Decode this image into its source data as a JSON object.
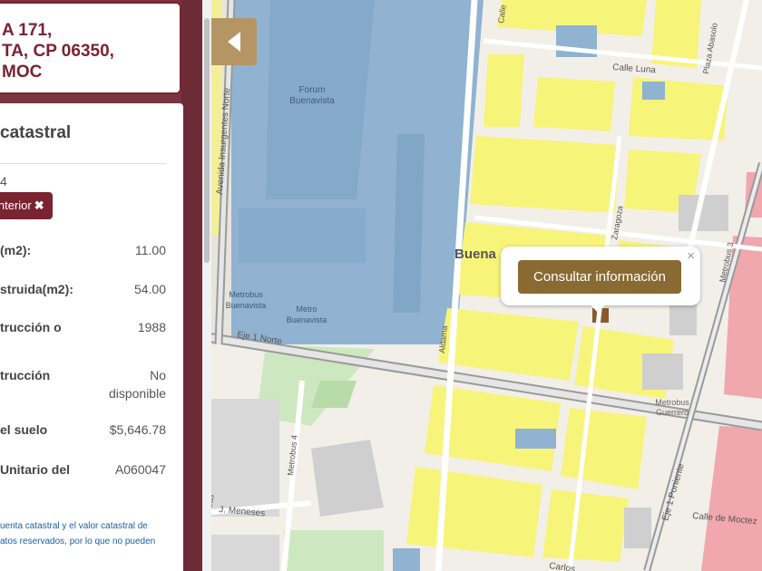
{
  "address": {
    "text": "A 171,\nTA, CP 06350,\nMOC"
  },
  "info": {
    "title": "catastral",
    "number_partial": "4",
    "tag_label": "interior",
    "tag_close_icon": "close-icon",
    "rows": [
      {
        "label": "(m2):",
        "value": "11.00"
      },
      {
        "label": "struida(m2):",
        "value": "54.00"
      },
      {
        "label": "trucción o",
        "value": "1988"
      },
      {
        "label": "trucción",
        "value": "No disponible"
      },
      {
        "label": "el suelo",
        "value": "$5,646.78"
      },
      {
        "label": "Unitario del",
        "value": "A060047"
      }
    ],
    "disclaimer": "uenta catastral y el valor catastral de\natos reservados, por lo que no pueden"
  },
  "panel_toggle": {
    "icon": "chevron-left-icon"
  },
  "popup": {
    "button_label": "Consultar información",
    "close_label": "×"
  },
  "map": {
    "colors": {
      "federal": "#8fb3d0",
      "habitacional": "#f7f47a",
      "mixto": "#f0a7ae",
      "selected": "#8b5a2b",
      "base": "#f2efe9",
      "park": "#cde8c0"
    },
    "labels": {
      "forum": "Forum\nBuenavista",
      "metrobus_bv": "Metrobus\nBuenavista",
      "metro_bv": "Metro\nBuenavista",
      "neighborhood": "Buena",
      "metrobus_guerrero": "Metrobus\nGuerrero",
      "av_insurgentes": "Avenida Insurgentes Norte",
      "eje1_norte": "Eje 1 Norte",
      "aldama": "Aldama",
      "zaragoza": "Zaragoza",
      "calle_luna": "Calle Luna",
      "plaza_abasolo": "Plaza Abasolo",
      "calle": "Calle",
      "metrobus3": "Metrobus 3",
      "metrobus4": "Metrobus 4",
      "eje1_poniente": "Eje 1 Poniente",
      "j_meneses": "J. Meneses",
      "calle_moctezuma": "Calle de Moctez",
      "carlos": "Carlos",
      "cas": "Cas"
    }
  }
}
